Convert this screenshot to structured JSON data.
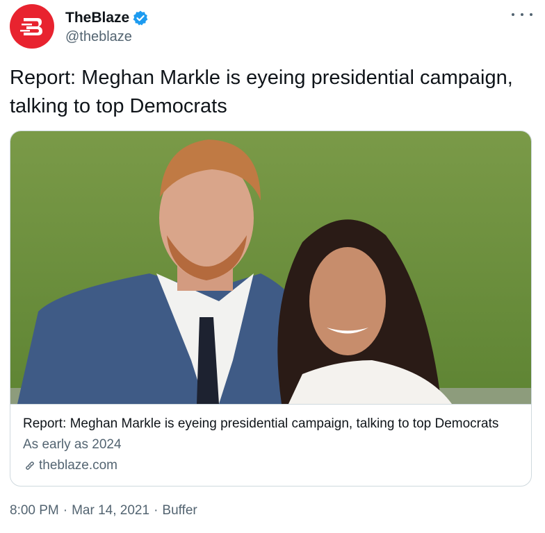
{
  "account": {
    "display_name": "TheBlaze",
    "handle": "@theblaze",
    "avatar_icon": "theblaze-logo-icon",
    "verified_icon": "verified-badge-icon",
    "brand_color": "#e8232f",
    "verified_color": "#1d9bf0"
  },
  "tweet": {
    "text": "Report: Meghan Markle is eyeing presidential campaign, talking to top Democrats"
  },
  "card": {
    "image_icon": "article-photo",
    "title": "Report: Meghan Markle is eyeing presidential campaign, talking to top Democrats",
    "description": "As early as 2024",
    "domain": "theblaze.com",
    "domain_icon": "link-icon"
  },
  "meta": {
    "time": "8:00 PM",
    "separator": "·",
    "date": "Mar 14, 2021",
    "source": "Buffer"
  },
  "menu": {
    "more_icon": "more-options-icon"
  }
}
